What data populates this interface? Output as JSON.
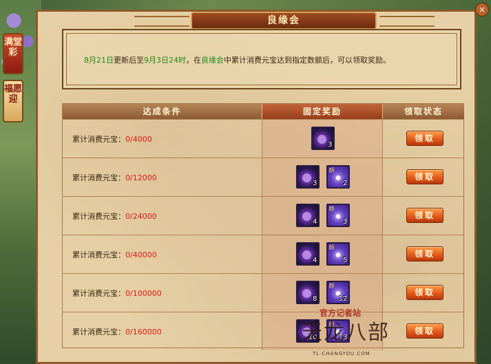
{
  "window": {
    "title": "良缘会",
    "close_label": "×"
  },
  "side_tabs": [
    {
      "label": "满堂彩"
    },
    {
      "label": "福愿迎"
    }
  ],
  "info": {
    "date_start": "8月21日",
    "part1": "更新后至",
    "date_end": "9月3日24时",
    "part2": "，在",
    "event_name": "良缘会",
    "part3": "中累计消费元宝达到指定数额后，可以领取奖励。"
  },
  "table": {
    "headers": {
      "condition": "达成条件",
      "reward": "固定奖励",
      "status": "领取状态"
    },
    "rows": [
      {
        "label": "累计消费元宝：",
        "progress": "0/4000",
        "rewards": [
          {
            "icon": "ore-icon",
            "count": "3"
          }
        ],
        "button": "领取"
      },
      {
        "label": "累计消费元宝：",
        "progress": "0/12000",
        "rewards": [
          {
            "icon": "ore-icon",
            "count": "3"
          },
          {
            "icon": "gem-icon",
            "count": "2"
          }
        ],
        "button": "领取"
      },
      {
        "label": "累计消费元宝：",
        "progress": "0/24000",
        "rewards": [
          {
            "icon": "ore-icon",
            "count": "4"
          },
          {
            "icon": "gem-icon",
            "count": "3"
          }
        ],
        "button": "领取"
      },
      {
        "label": "累计消费元宝：",
        "progress": "0/40000",
        "rewards": [
          {
            "icon": "ore-icon",
            "count": "4"
          },
          {
            "icon": "gem-icon",
            "count": "5"
          }
        ],
        "button": "领取"
      },
      {
        "label": "累计消费元宝：",
        "progress": "0/100000",
        "rewards": [
          {
            "icon": "ore-icon",
            "count": "8"
          },
          {
            "icon": "gem-icon",
            "count": "12"
          }
        ],
        "button": "领取"
      },
      {
        "label": "累计消费元宝：",
        "progress": "0/160000",
        "rewards": [
          {
            "icon": "ore-icon",
            "count": "10"
          },
          {
            "icon": "gem-icon",
            "count": "13"
          }
        ],
        "button": "领取"
      }
    ],
    "gem_mark": "颜"
  },
  "watermark": {
    "top": "官方记者站",
    "main": "天龙八部",
    "url": "TL.CHANGYOU.COM"
  }
}
